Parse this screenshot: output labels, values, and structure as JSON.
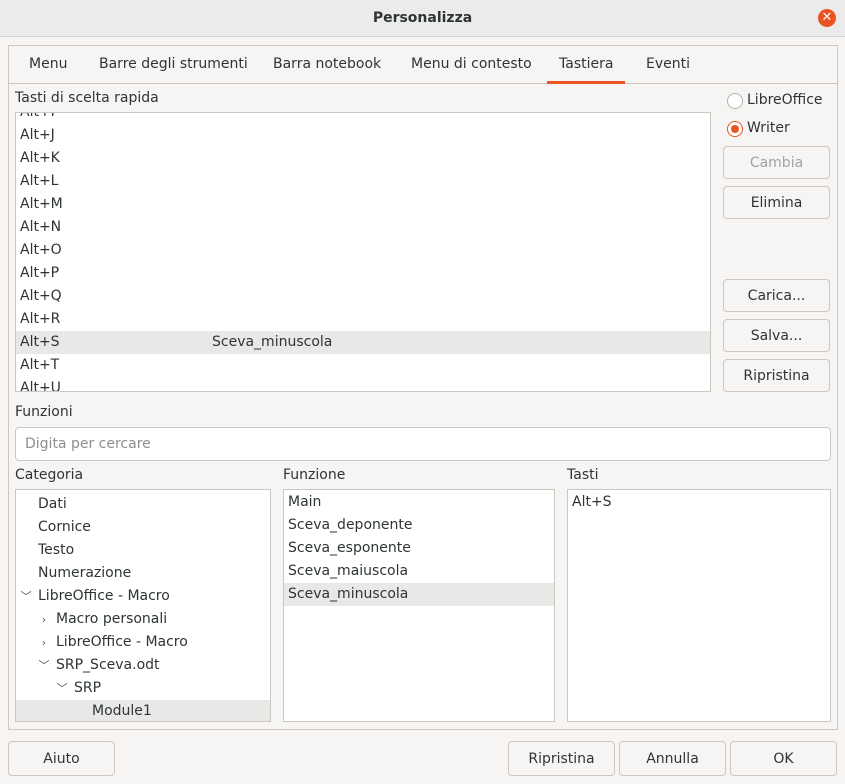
{
  "window": {
    "title": "Personalizza"
  },
  "tabs": [
    {
      "label": "Menu"
    },
    {
      "label": "Barre degli strumenti"
    },
    {
      "label": "Barra notebook"
    },
    {
      "label": "Menu di contesto"
    },
    {
      "label": "Tastiera"
    },
    {
      "label": "Eventi"
    }
  ],
  "shortcuts": {
    "label": "Tasti di scelta rapida",
    "rows": [
      {
        "key": "Alt+I",
        "command": ""
      },
      {
        "key": "Alt+J",
        "command": ""
      },
      {
        "key": "Alt+K",
        "command": ""
      },
      {
        "key": "Alt+L",
        "command": ""
      },
      {
        "key": "Alt+M",
        "command": ""
      },
      {
        "key": "Alt+N",
        "command": ""
      },
      {
        "key": "Alt+O",
        "command": ""
      },
      {
        "key": "Alt+P",
        "command": ""
      },
      {
        "key": "Alt+Q",
        "command": ""
      },
      {
        "key": "Alt+R",
        "command": ""
      },
      {
        "key": "Alt+S",
        "command": "Sceva_minuscola"
      },
      {
        "key": "Alt+T",
        "command": ""
      },
      {
        "key": "Alt+U",
        "command": ""
      }
    ]
  },
  "scope": {
    "options": [
      {
        "label": "LibreOffice",
        "selected": false
      },
      {
        "label": "Writer",
        "selected": true
      }
    ]
  },
  "actions": {
    "change": "Cambia",
    "delete": "Elimina",
    "load": "Carica...",
    "save": "Salva...",
    "reset": "Ripristina"
  },
  "functions": {
    "label": "Funzioni",
    "search_placeholder": "Digita per cercare",
    "category_label": "Categoria",
    "function_label": "Funzione",
    "keys_label": "Tasti",
    "categories": [
      {
        "label": "Dati"
      },
      {
        "label": "Cornice"
      },
      {
        "label": "Testo"
      },
      {
        "label": "Numerazione"
      },
      {
        "label": "LibreOffice - Macro"
      },
      {
        "label": "Macro personali"
      },
      {
        "label": "LibreOffice - Macro"
      },
      {
        "label": "SRP_Sceva.odt"
      },
      {
        "label": "SRP"
      },
      {
        "label": "Module1"
      }
    ],
    "function_items": [
      {
        "label": "Main"
      },
      {
        "label": "Sceva_deponente"
      },
      {
        "label": "Sceva_esponente"
      },
      {
        "label": "Sceva_maiuscola"
      },
      {
        "label": "Sceva_minuscola"
      }
    ],
    "keys": [
      {
        "label": "Alt+S"
      }
    ]
  },
  "footer": {
    "help": "Aiuto",
    "reset": "Ripristina",
    "cancel": "Annulla",
    "ok": "OK"
  },
  "colors": {
    "accent": "#e95420",
    "selection": "#e8e8e7"
  }
}
